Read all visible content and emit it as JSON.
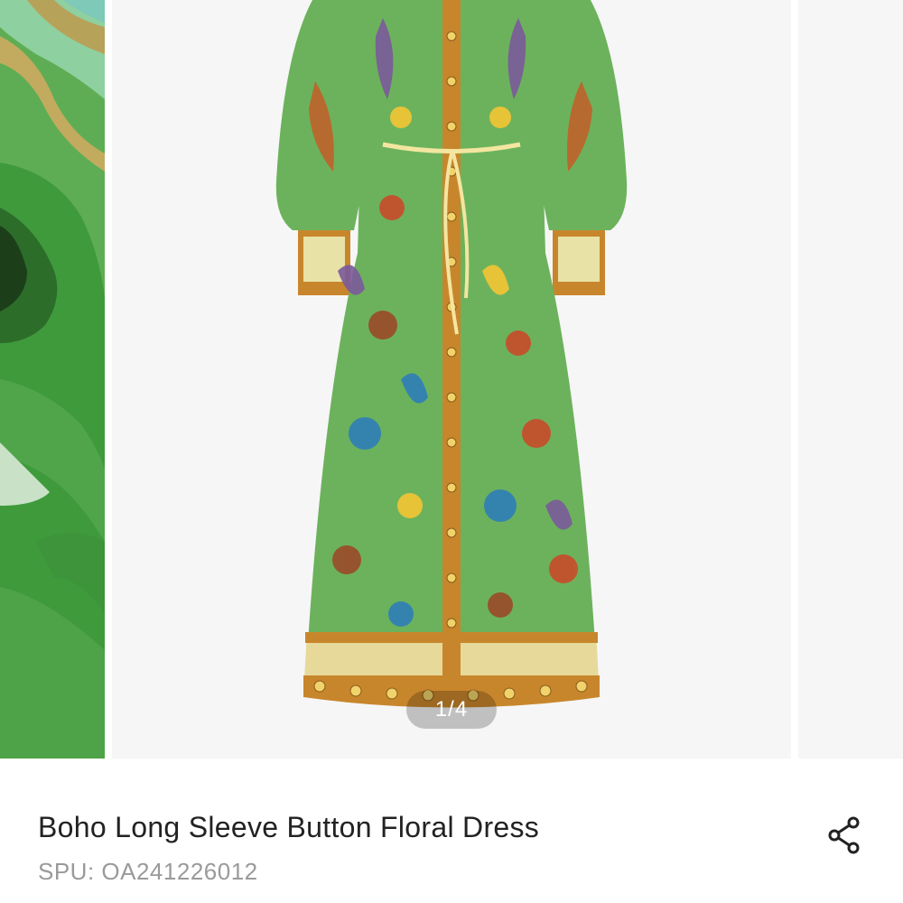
{
  "gallery": {
    "current_index": "1",
    "total": "4",
    "indicator": "1/4",
    "slides": [
      {
        "alt": "green fabric close-up"
      },
      {
        "alt": "green floral print dress"
      },
      {
        "alt": "next product image"
      }
    ]
  },
  "product": {
    "title": "Boho Long Sleeve Button Floral Dress",
    "spu": "SPU: OA241226012"
  },
  "icons": {
    "share": "share-icon"
  },
  "colors": {
    "dress_green": "#6cb25c",
    "trim_orange": "#c8862c",
    "title_text": "#222222",
    "spu_text": "#9a9a9a"
  }
}
